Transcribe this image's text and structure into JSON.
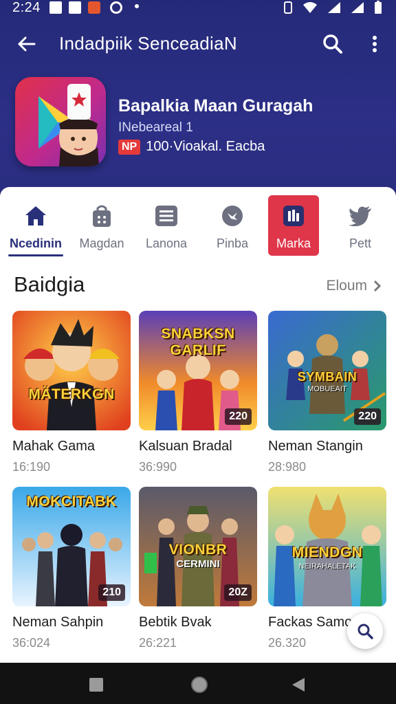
{
  "status_bar": {
    "time": "2:24"
  },
  "app_bar": {
    "title": "Indadpiik SenceadiaN",
    "back_icon": "arrow-left-icon",
    "search_icon": "search-icon",
    "more_icon": "more-vertical-icon"
  },
  "app_header": {
    "name": "Bapalkia Maan Guragah",
    "subtitle": "INebeareal 1",
    "badge": "NP",
    "meta": "100·Vioakal. Eacba"
  },
  "tabs": [
    {
      "label": "Ncedinin",
      "icon": "home-icon",
      "active": true
    },
    {
      "label": "Magdan",
      "icon": "shopping-bag-icon",
      "active": false
    },
    {
      "label": "Lanona",
      "icon": "list-icon",
      "active": false
    },
    {
      "label": "Pinba",
      "icon": "chat-bubble-icon",
      "active": false
    },
    {
      "label": "Marka",
      "icon": "bar-chart-icon",
      "active": false,
      "highlighted": true
    },
    {
      "label": "Pett",
      "icon": "bird-icon",
      "active": false
    }
  ],
  "section": {
    "title": "Baidgia",
    "more_label": "Eloum"
  },
  "cards": [
    {
      "title": "Mahak Gama",
      "meta": "16:190",
      "thumb_title": "MÄTERKGN",
      "thumb_sub": "",
      "badge": ""
    },
    {
      "title": "Kalsuan Bradal",
      "meta": "36:990",
      "thumb_title": "SNABKSN GARLIF",
      "thumb_sub": "",
      "badge": "220"
    },
    {
      "title": "Neman Stangin",
      "meta": "28:980",
      "thumb_title": "SYMBAIN",
      "thumb_sub": "MOBUEAIT",
      "badge": "220"
    },
    {
      "title": "Neman Sahpin",
      "meta": "36:024",
      "thumb_title": "MOKCITABK",
      "thumb_sub": "",
      "badge": "210"
    },
    {
      "title": "Bebtik Bvak",
      "meta": "26:221",
      "thumb_title": "VIONBR",
      "thumb_sub": "CERMINI",
      "badge": "20Z"
    },
    {
      "title": "Fackas Samo",
      "meta": "26.320",
      "thumb_title": "MIENDGN",
      "thumb_sub": "NEIRAHALETAK",
      "badge": ""
    }
  ],
  "fab": {
    "icon": "search-icon"
  },
  "nav_bar": {
    "recents_icon": "square-recents-icon",
    "home_icon": "circle-home-icon",
    "back_icon": "triangle-back-icon"
  }
}
